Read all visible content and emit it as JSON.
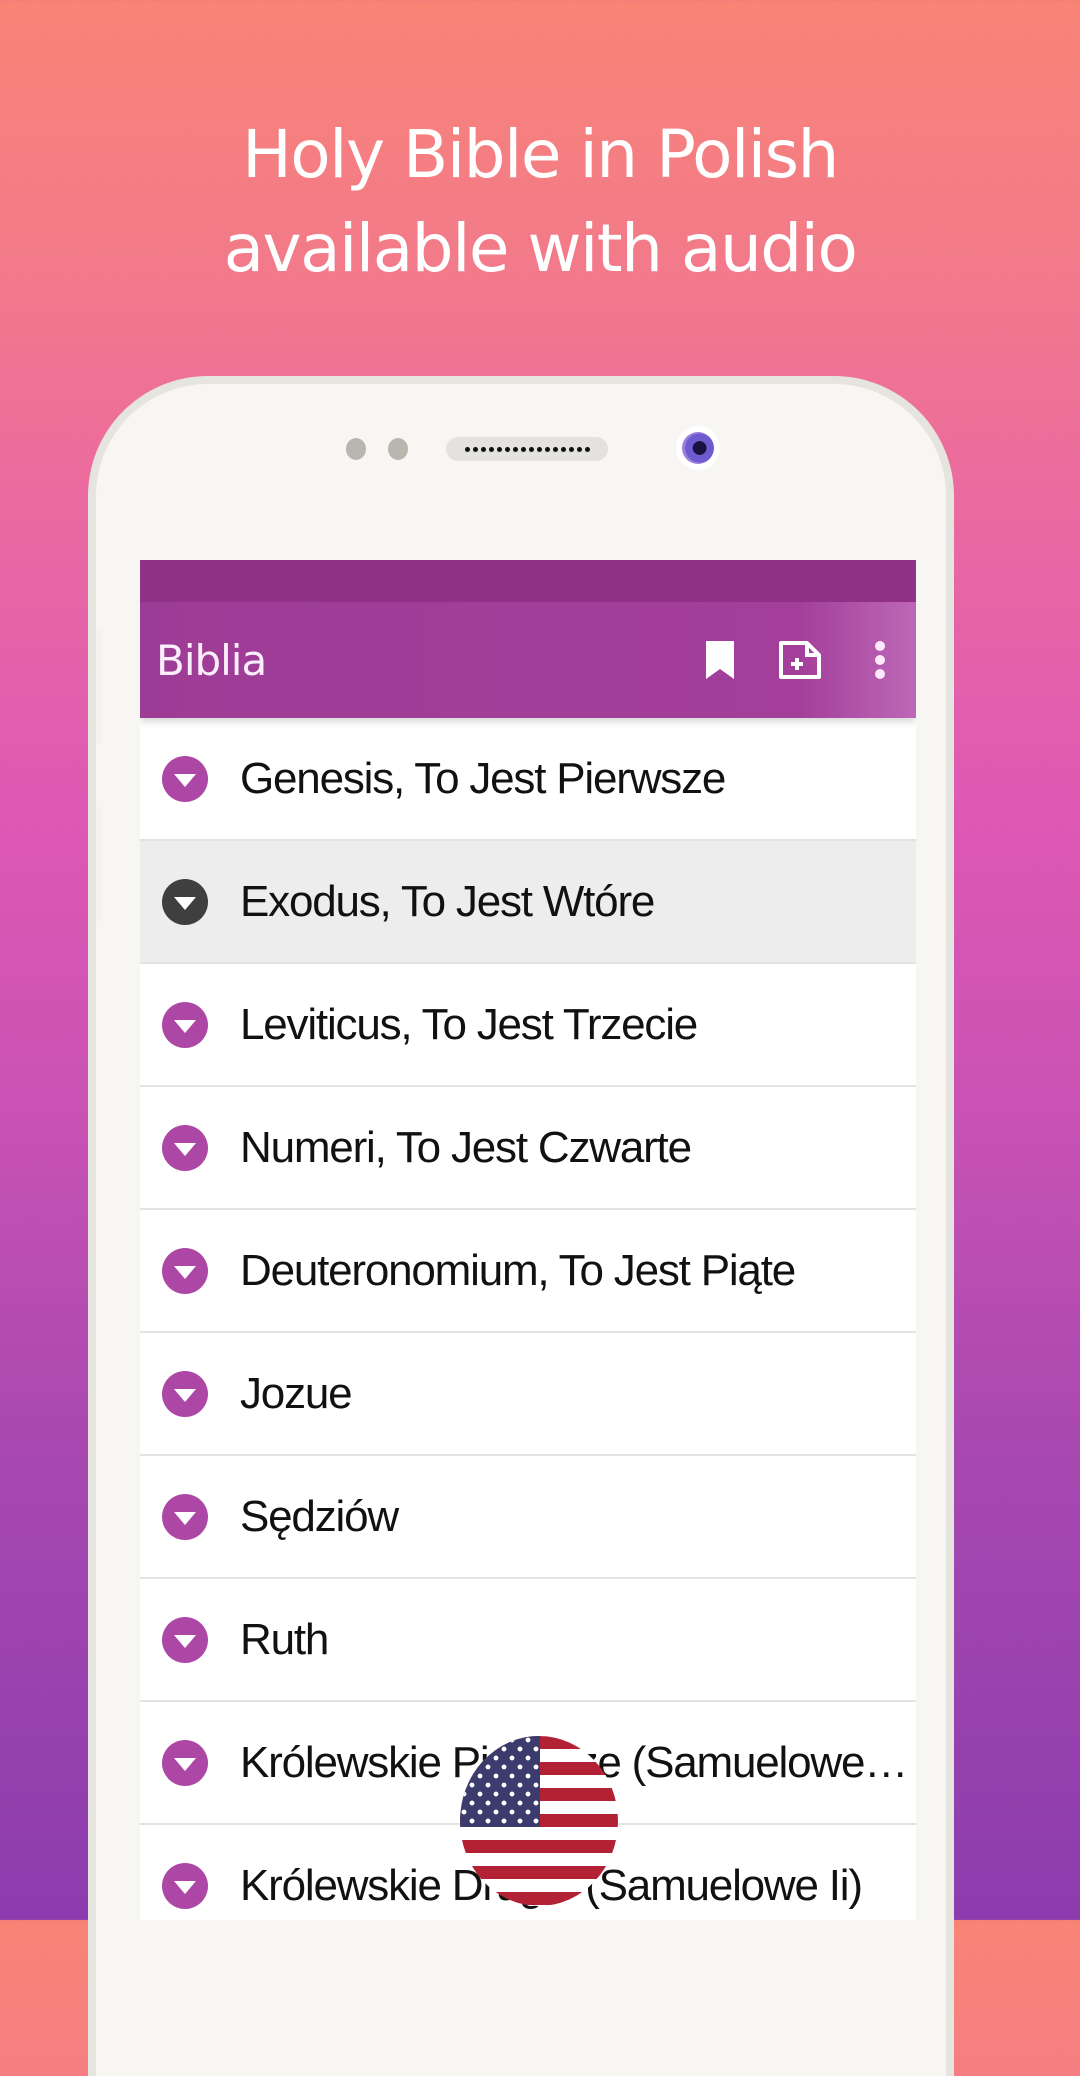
{
  "headline": {
    "line1": "Holy Bible in Polish",
    "line2": "available with audio"
  },
  "app": {
    "title": "Biblia",
    "actions": [
      {
        "name": "bookmark-icon",
        "label": "Bookmarks"
      },
      {
        "name": "add-note-icon",
        "label": "Add note"
      },
      {
        "name": "more-vert-icon",
        "label": "More options"
      }
    ],
    "colors": {
      "accent": "#a33f9b",
      "status_bar": "#913288",
      "selected_chevron": "#3f3f3f"
    }
  },
  "books": [
    {
      "label": "Genesis, To Jest Pierwsze",
      "selected": false
    },
    {
      "label": "Exodus, To Jest Wtóre",
      "selected": true
    },
    {
      "label": "Leviticus, To Jest Trzecie",
      "selected": false
    },
    {
      "label": "Numeri, To Jest Czwarte",
      "selected": false
    },
    {
      "label": "Deuteronomium, To Jest Piąte",
      "selected": false
    },
    {
      "label": "Jozue",
      "selected": false
    },
    {
      "label": "Sędziów",
      "selected": false
    },
    {
      "label": "Ruth",
      "selected": false
    },
    {
      "label": "Królewskie Pierwsze (Samuelowe…",
      "selected": false
    },
    {
      "label": "Królewskie Drugie (Samuelowe Ii)",
      "selected": false
    }
  ],
  "overlay": {
    "flag": "us-flag-icon"
  }
}
